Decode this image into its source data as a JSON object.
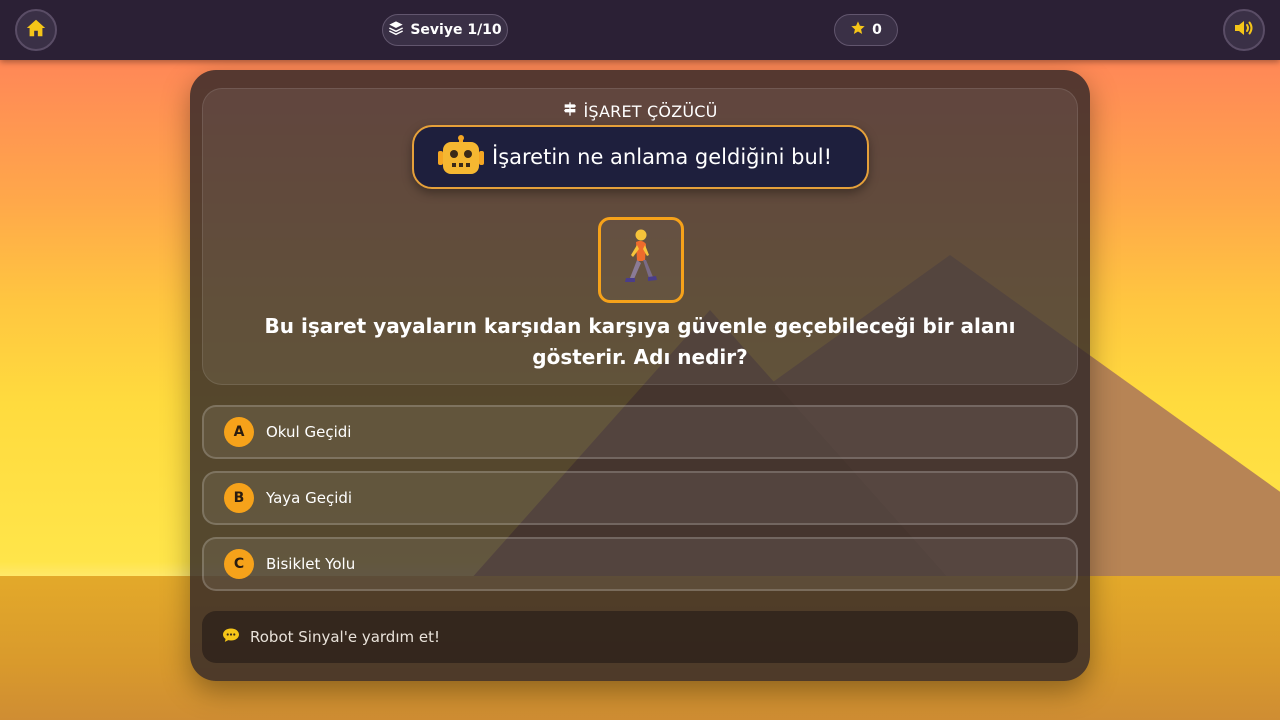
{
  "topbar": {
    "home_icon": "home-icon",
    "level_icon": "layers-icon",
    "level_label": "Seviye 1/10",
    "score_icon": "star-icon",
    "score_value": "0",
    "sound_icon": "speaker-icon"
  },
  "card": {
    "section_icon": "signpost-icon",
    "section_title": "İŞARET ÇÖZÜCÜ",
    "robot_icon": "robot-icon",
    "robot_message": "İşaretin ne anlama geldiğini bul!",
    "sign_icon": "pedestrian-walking-icon",
    "question": "Bu işaret yayaların karşıdan karşıya güvenle geçebileceği bir alanı gösterir. Adı nedir?"
  },
  "options": [
    {
      "letter": "A",
      "label": "Okul Geçidi"
    },
    {
      "letter": "B",
      "label": "Yaya Geçidi"
    },
    {
      "letter": "C",
      "label": "Bisiklet Yolu"
    }
  ],
  "hint": {
    "icon": "speech-bubble-icon",
    "text": "Robot Sinyal'e yardım et!"
  },
  "colors": {
    "accent": "#f6a21a",
    "topbar": "#2b2035",
    "bubble": "#1e1f3d"
  }
}
